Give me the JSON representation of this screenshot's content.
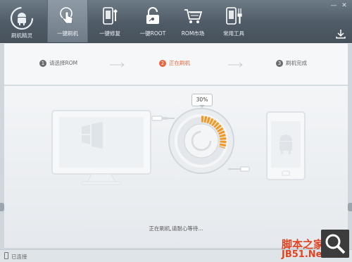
{
  "brand": {
    "label": "刷机精灵"
  },
  "nav": [
    {
      "label": "一键刷机",
      "icon": "hand-touch-icon",
      "active": true
    },
    {
      "label": "一键修复",
      "icon": "phone-wrench-icon",
      "active": false
    },
    {
      "label": "一键ROOT",
      "icon": "unlock-icon",
      "active": false
    },
    {
      "label": "ROM市场",
      "icon": "cart-icon",
      "active": false
    },
    {
      "label": "常用工具",
      "icon": "phone-tools-icon",
      "active": false
    }
  ],
  "window": {
    "minimize": "—",
    "close": "✕"
  },
  "steps": [
    {
      "num": "1",
      "label": "请选择ROM"
    },
    {
      "num": "2",
      "label": "正在刷机"
    },
    {
      "num": "3",
      "label": "刷机完成"
    }
  ],
  "current_step": 2,
  "progress": {
    "text": "30%",
    "fraction": 0.3
  },
  "status_text": "正在刷机,请耐心等待...",
  "statusbar": {
    "text": "已连接"
  },
  "watermark": {
    "line1": "脚本之家",
    "line2": "JB51.Net"
  },
  "colors": {
    "accent": "#e8643c",
    "progress_orange": "#f29a1f",
    "topbar": "#55616c"
  }
}
